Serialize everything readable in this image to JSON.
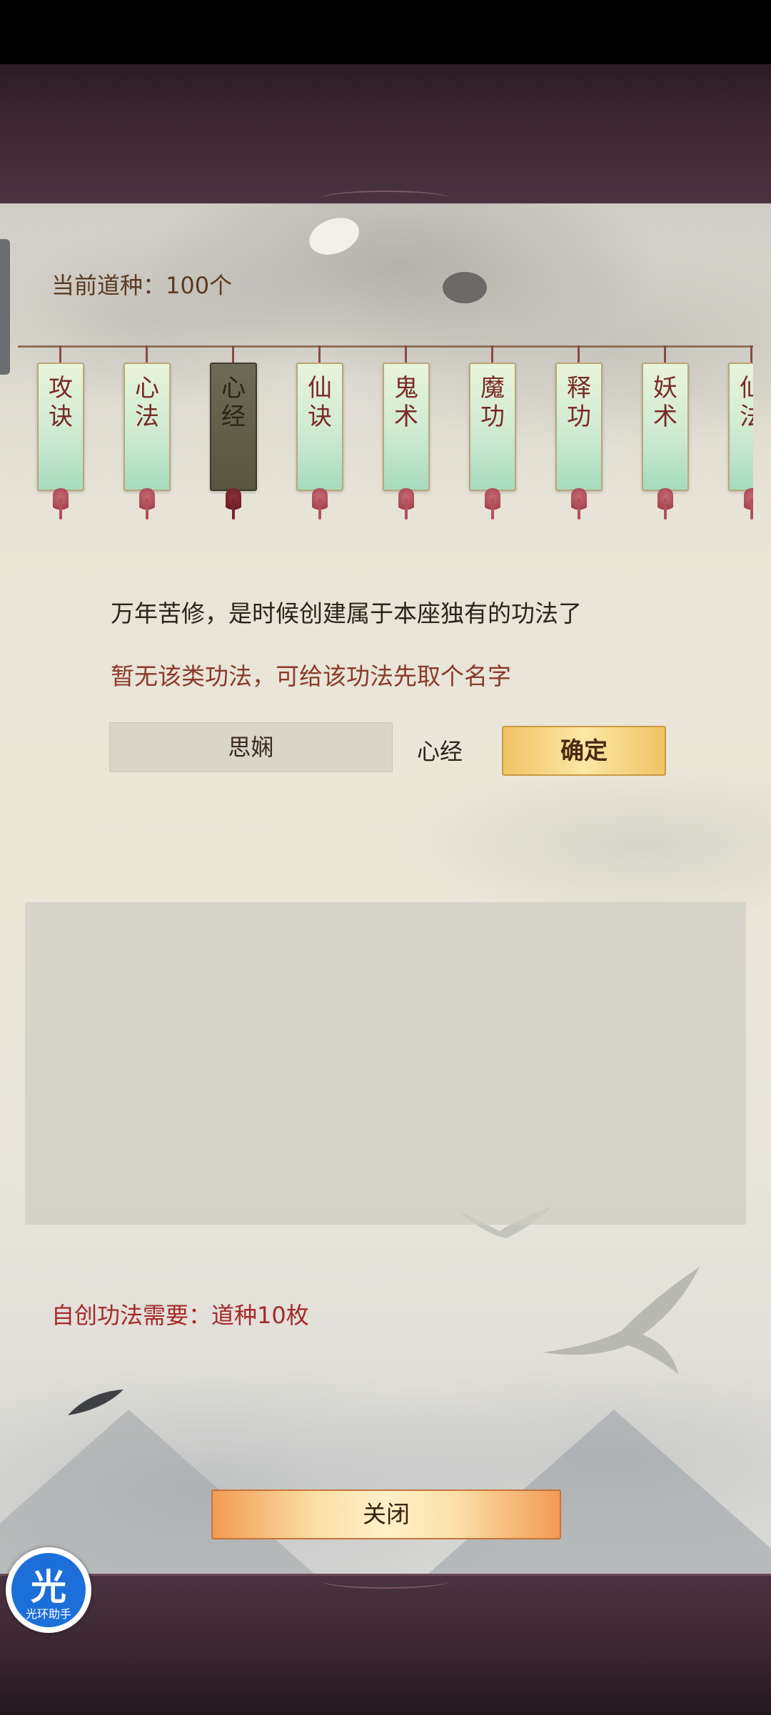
{
  "currency": {
    "label": "当前道种：100个"
  },
  "categories": [
    {
      "label": "攻诀",
      "active": false
    },
    {
      "label": "心法",
      "active": false
    },
    {
      "label": "心经",
      "active": true
    },
    {
      "label": "仙诀",
      "active": false
    },
    {
      "label": "鬼术",
      "active": false
    },
    {
      "label": "魔功",
      "active": false
    },
    {
      "label": "释功",
      "active": false
    },
    {
      "label": "妖术",
      "active": false
    },
    {
      "label": "仙法",
      "active": false
    }
  ],
  "intro": {
    "line1": "万年苦修，是时候创建属于本座独有的功法了",
    "line2": "暂无该类功法，可给该功法先取个名字"
  },
  "name_form": {
    "input_value": "思娴",
    "suffix": "心经",
    "confirm_label": "确定"
  },
  "cost": {
    "label": "自创功法需要：道种10枚"
  },
  "close_label": "关闭",
  "overlay_badge": {
    "glyph": "光",
    "caption": "光环助手"
  },
  "colors": {
    "frame": "#3d2833",
    "tag_green": "#cfead2",
    "tag_active": "#58563f",
    "confirm_gold": "#f1c364",
    "close_orange": "#f29b52",
    "cost_red": "#a52a2a",
    "badge_blue": "#1c6fd9"
  }
}
